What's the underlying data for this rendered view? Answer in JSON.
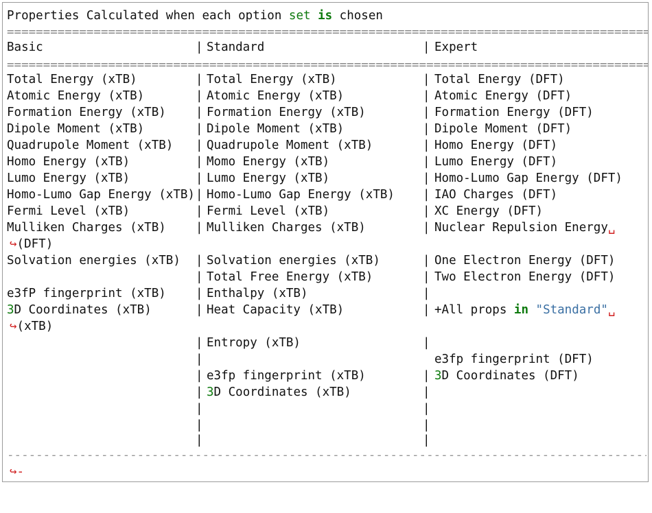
{
  "title": {
    "prefix": "Properties Calculated when each option ",
    "kw_set": "set",
    "space": " ",
    "kw_is": "is",
    "suffix": " chosen"
  },
  "headers": [
    "Basic",
    "Standard",
    "Expert"
  ],
  "separator": "|",
  "rows": [
    [
      "Total Energy (xTB)",
      "Total Energy (xTB)",
      "Total Energy (DFT)"
    ],
    [
      "Atomic Energy (xTB)",
      "Atomic Energy (xTB)",
      "Atomic Energy (DFT)"
    ],
    [
      "Formation Energy (xTB)",
      "Formation Energy (xTB)",
      "Formation Energy (DFT)"
    ],
    [
      "Dipole Moment (xTB)",
      "Dipole Moment (xTB)",
      "Dipole Moment (DFT)"
    ],
    [
      "Quadrupole Moment (xTB)",
      "Quadrupole Moment (xTB)",
      "Homo Energy (DFT)"
    ],
    [
      "Homo Energy (xTB)",
      "Momo Energy (xTB)",
      "Lumo Energy (DFT)"
    ],
    [
      "Lumo Energy (xTB)",
      "Lumo Energy (xTB)",
      "Homo-Lumo Gap Energy (DFT)"
    ],
    [
      "Homo-Lumo Gap Energy (xTB)",
      "Homo-Lumo Gap Energy (xTB)",
      "IAO Charges (DFT)"
    ],
    [
      "Fermi Level (xTB)",
      "Fermi Level (xTB)",
      "XC Energy (DFT)"
    ],
    [
      "Mulliken Charges (xTB)",
      "Mulliken Charges (xTB)",
      "Nuclear Repulsion Energy"
    ],
    [
      "(DFT)",
      "",
      ""
    ],
    [
      "Solvation energies (xTB)",
      "Solvation energies (xTB)",
      "One Electron Energy (DFT)"
    ],
    [
      "",
      "Total Free Energy (xTB)",
      "Two Electron Energy (DFT)"
    ],
    [
      "e3fP fingerprint (xTB)",
      "Enthalpy (xTB)",
      ""
    ],
    [
      "3D Coordinates (xTB)",
      "Heat Capacity (xTB)",
      "+All props in \"Standard\""
    ],
    [
      "(xTB)",
      "",
      ""
    ],
    [
      "",
      "Entropy (xTB)",
      ""
    ],
    [
      "",
      "",
      "e3fp fingerprint (DFT)"
    ],
    [
      "",
      "e3fp fingerprint (xTB)",
      "3D Coordinates (DFT)"
    ],
    [
      "",
      "3D Coordinates (xTB)",
      ""
    ]
  ],
  "tokens": {
    "digit3": "3",
    "d_coords_xtb": "D Coordinates (xTB)",
    "d_coords_dft": "D Coordinates (DFT)",
    "plus_all_props": "+All props ",
    "in_kw": "in",
    "standard_str": "\"Standard\"",
    "continuation_arrow": "↪",
    "wrap_mark": "␣",
    "final_dash": "-"
  },
  "colors": {
    "keyword": "#0e7a0e",
    "string": "#3a6fa3",
    "wrap_arrow": "#d02020"
  }
}
